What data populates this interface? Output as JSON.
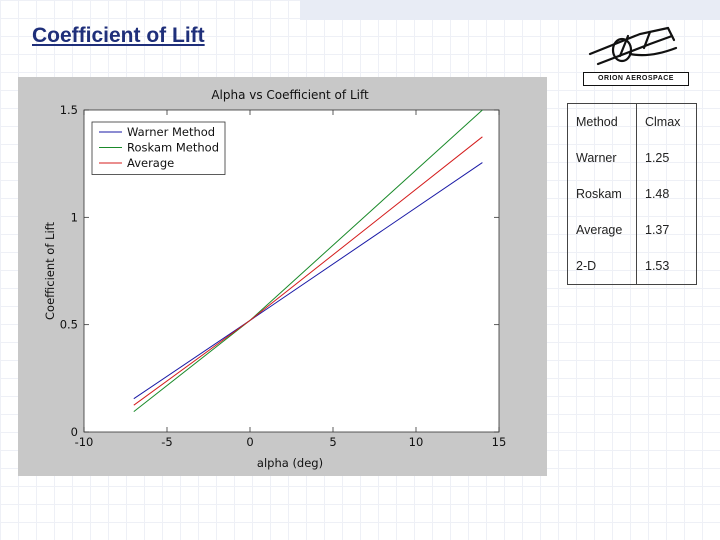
{
  "slide": {
    "title": "Coefficient of Lift",
    "logo_text": "ORION AEROSPACE"
  },
  "table": {
    "header": [
      "Method",
      "Clmax"
    ],
    "rows": [
      [
        "Warner",
        "1.25"
      ],
      [
        "Roskam",
        "1.48"
      ],
      [
        "Average",
        "1.37"
      ],
      [
        "2-D",
        "1.53"
      ]
    ]
  },
  "chart_data": {
    "type": "line",
    "title": "Alpha vs Coefficient of Lift",
    "xlabel": "alpha (deg)",
    "ylabel": "Coefficient of Lift",
    "xlim": [
      -10,
      15
    ],
    "ylim": [
      0,
      1.5
    ],
    "xticks": [
      -10,
      -5,
      0,
      5,
      10,
      15
    ],
    "yticks": [
      0,
      0.5,
      1,
      1.5
    ],
    "grid": false,
    "legend_position": "top-left",
    "series": [
      {
        "name": "Warner Method",
        "color": "#1a1aa6",
        "x": [
          -7,
          0,
          14
        ],
        "y": [
          0.155,
          0.52,
          1.255
        ]
      },
      {
        "name": "Roskam Method",
        "color": "#1a8a2a",
        "x": [
          -7,
          0,
          14
        ],
        "y": [
          0.095,
          0.52,
          1.5
        ]
      },
      {
        "name": "Average",
        "color": "#d41c1c",
        "x": [
          -7,
          0,
          14
        ],
        "y": [
          0.125,
          0.52,
          1.375
        ]
      }
    ],
    "plot_background": "#ffffff",
    "figure_background": "#c8c8c8"
  }
}
